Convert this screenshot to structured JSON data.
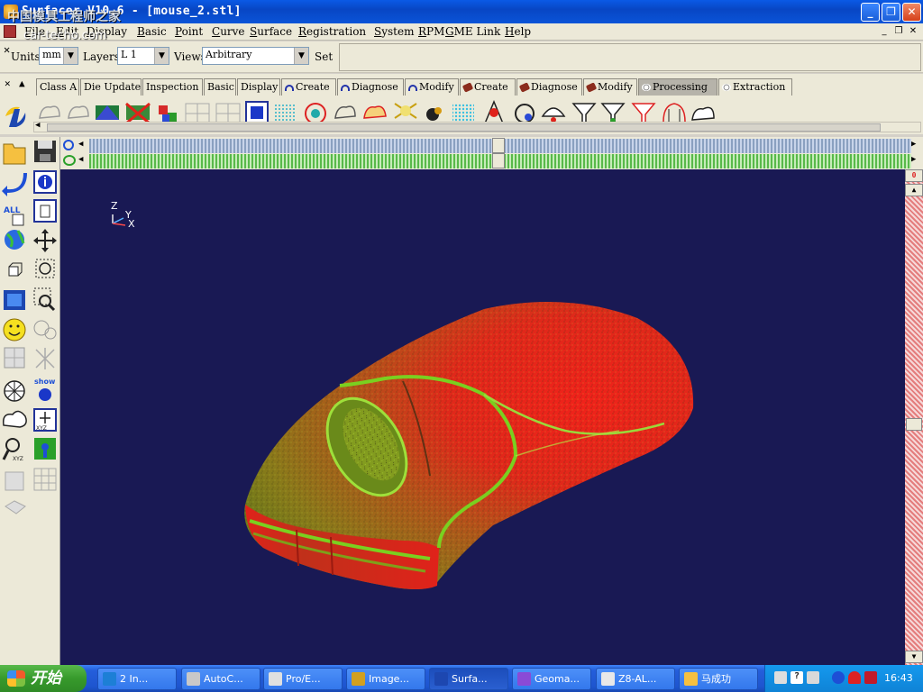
{
  "window": {
    "title": "Surfacer V10.6 - [mouse_2.stl]",
    "watermark": "中国模具工程师之家",
    "watermark_url": "car-techo.com"
  },
  "menu": [
    "File",
    "Edit",
    "Display",
    "Basic",
    "Point",
    "Curve",
    "Surface",
    "Registration",
    "System",
    "RPM",
    "GME Link",
    "Help"
  ],
  "units_toolbar": {
    "units_label": "Units",
    "units_value": "mm",
    "layers_label": "Layers",
    "layers_value": "L 1",
    "views_label": "Views",
    "views_value": "Arbitrary",
    "set_label": "Set"
  },
  "tabs": [
    {
      "label": "Class A",
      "icon": "none"
    },
    {
      "label": "Die Update",
      "icon": "none"
    },
    {
      "label": "Inspection",
      "icon": "none"
    },
    {
      "label": "Basic",
      "icon": "none"
    },
    {
      "label": "Display",
      "icon": "none"
    },
    {
      "label": "Create",
      "icon": "blue-curve"
    },
    {
      "label": "Diagnose",
      "icon": "blue-curve"
    },
    {
      "label": "Modify",
      "icon": "blue-curve"
    },
    {
      "label": "Create",
      "icon": "brown-surface"
    },
    {
      "label": "Diagnose",
      "icon": "brown-surface"
    },
    {
      "label": "Modify",
      "icon": "brown-surface"
    },
    {
      "label": "Processing",
      "icon": "cloud",
      "active": true
    },
    {
      "label": "Extraction",
      "icon": "cloud"
    }
  ],
  "viewport": {
    "background": "#191954",
    "axis_labels": {
      "z": "Z",
      "y": "Y",
      "x": "X"
    }
  },
  "taskbar": {
    "start_label": "开始",
    "tasks": [
      {
        "label": "2 In...",
        "icon": "ie-icon"
      },
      {
        "label": "AutoC...",
        "icon": "autocad-icon"
      },
      {
        "label": "Pro/E...",
        "icon": "proe-icon"
      },
      {
        "label": "Image...",
        "icon": "image-icon"
      },
      {
        "label": "Surfa...",
        "icon": "surfacer-icon",
        "active": true
      },
      {
        "label": "Geoma...",
        "icon": "geomagic-icon"
      },
      {
        "label": "Z8-AL...",
        "icon": "z8-icon"
      },
      {
        "label": "马成功",
        "icon": "folder-icon"
      }
    ],
    "clock": "16:43"
  },
  "colors": {
    "title_blue": "#0a54d8",
    "viewport_bg": "#191954",
    "model_red": "#e0221a",
    "model_green": "#7ac21a",
    "start_green": "#379a2c"
  }
}
